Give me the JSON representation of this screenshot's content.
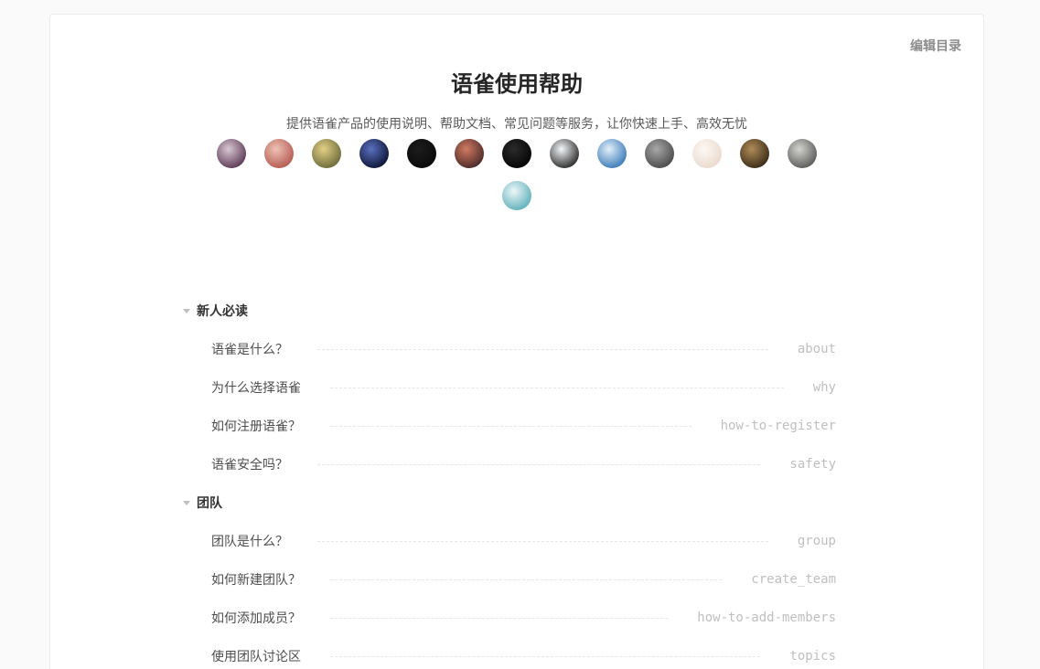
{
  "header": {
    "edit_catalog_label": "编辑目录"
  },
  "book": {
    "title": "语雀使用帮助",
    "description": "提供语雀产品的使用说明、帮助文档、常见问题等服务，让你快速上手、高效无忧"
  },
  "icons": {
    "catalog_group_toggle": "caret-down-icon"
  },
  "contributors": [
    {
      "light": "#d8c8d2",
      "dark": "#5b3a55"
    },
    {
      "light": "#f0c2b6",
      "dark": "#b35a50"
    },
    {
      "light": "#e3cf86",
      "dark": "#6b6a3a"
    },
    {
      "light": "#5a70c0",
      "dark": "#0d1433"
    },
    {
      "light": "#1c1c1c",
      "dark": "#0a0a0a"
    },
    {
      "light": "#d07a62",
      "dark": "#4a2a28"
    },
    {
      "light": "#2a2a2a",
      "dark": "#050505"
    },
    {
      "light": "#f4f8fb",
      "dark": "#2a2a2a"
    },
    {
      "light": "#e2f0fa",
      "dark": "#3a7ab8"
    },
    {
      "light": "#a8a8a8",
      "dark": "#4a4a4a"
    },
    {
      "light": "#fdf9f4",
      "dark": "#ead9cc"
    },
    {
      "light": "#b08c58",
      "dark": "#3a2a18"
    },
    {
      "light": "#d4d4cf",
      "dark": "#5a5a58"
    },
    {
      "light": "#eef7f8",
      "dark": "#5fb0bb"
    }
  ],
  "catalog": [
    {
      "title": "新人必读",
      "items": [
        {
          "title": "语雀是什么？",
          "slug": "about"
        },
        {
          "title": "为什么选择语雀",
          "slug": "why"
        },
        {
          "title": "如何注册语雀？",
          "slug": "how-to-register"
        },
        {
          "title": "语雀安全吗？",
          "slug": "safety"
        }
      ]
    },
    {
      "title": "团队",
      "items": [
        {
          "title": "团队是什么？",
          "slug": "group"
        },
        {
          "title": "如何新建团队？",
          "slug": "create_team"
        },
        {
          "title": "如何添加成员？",
          "slug": "how-to-add-members"
        },
        {
          "title": "使用团队讨论区",
          "slug": "topics"
        }
      ]
    }
  ]
}
